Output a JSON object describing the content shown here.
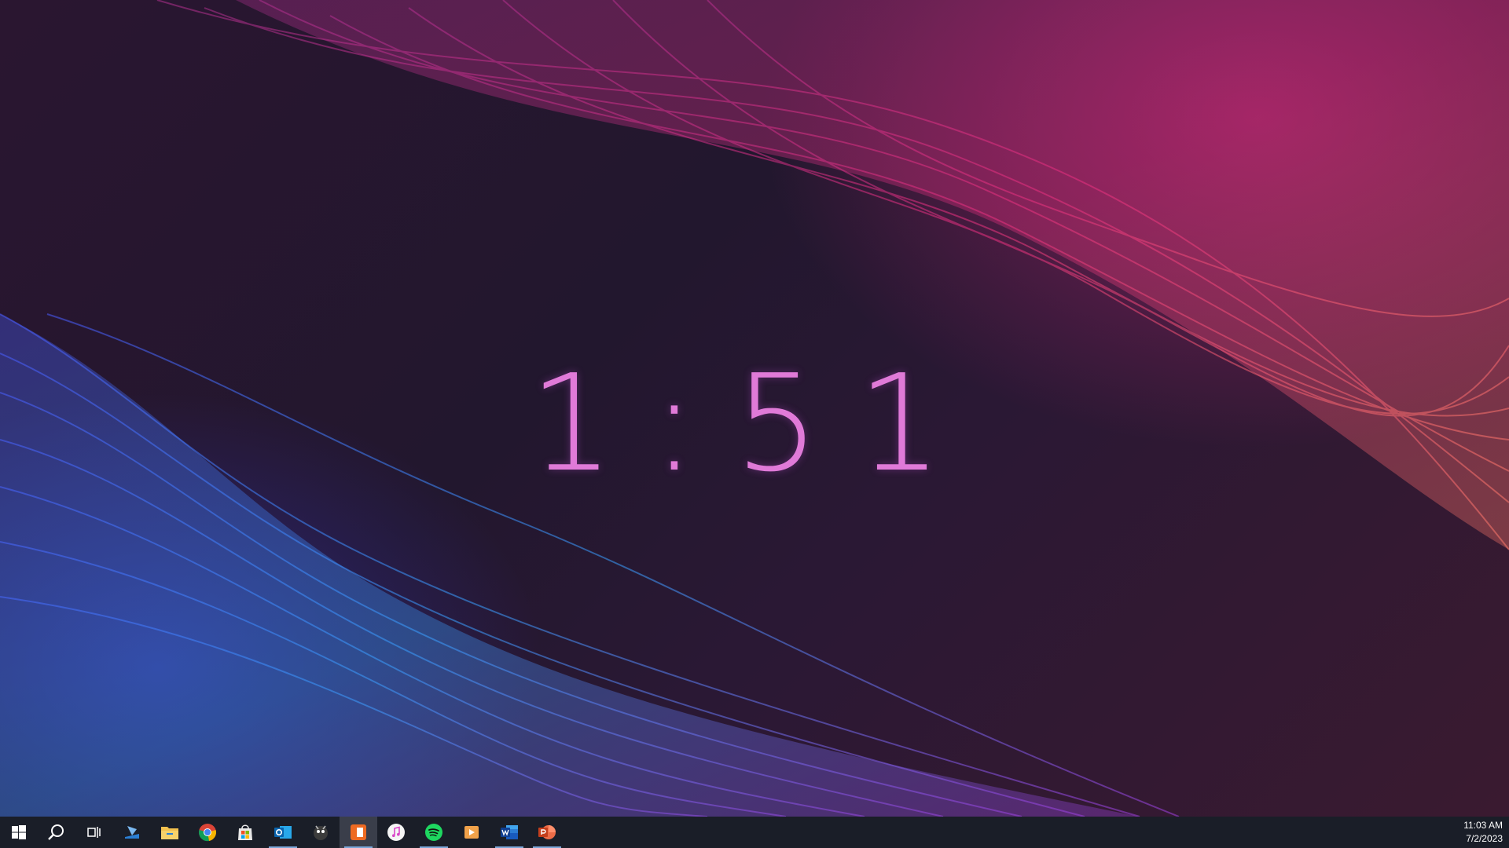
{
  "clock": {
    "hour": "1",
    "separator": ":",
    "minutes_tens": "5",
    "minutes_ones": "1",
    "color": "#e07ad8"
  },
  "taskbar": {
    "background": "#1a1e28",
    "items": [
      {
        "name": "start",
        "icon": "windows-logo-icon"
      },
      {
        "name": "search",
        "icon": "search-icon"
      },
      {
        "name": "task-view",
        "icon": "task-view-icon"
      },
      {
        "name": "app-1",
        "icon": "app-icon"
      },
      {
        "name": "file-explorer",
        "icon": "folder-icon"
      },
      {
        "name": "chrome",
        "icon": "chrome-icon"
      },
      {
        "name": "store",
        "icon": "store-icon"
      },
      {
        "name": "outlook",
        "icon": "outlook-icon"
      },
      {
        "name": "app-2",
        "icon": "app-icon"
      },
      {
        "name": "app-3",
        "icon": "app-icon"
      },
      {
        "name": "itunes",
        "icon": "music-icon"
      },
      {
        "name": "spotify",
        "icon": "spotify-icon"
      },
      {
        "name": "media-player",
        "icon": "play-icon"
      },
      {
        "name": "word",
        "icon": "word-icon"
      },
      {
        "name": "powerpoint",
        "icon": "powerpoint-icon"
      }
    ],
    "tray": {
      "time": "11:03 AM",
      "date": "7/2/2023"
    }
  }
}
